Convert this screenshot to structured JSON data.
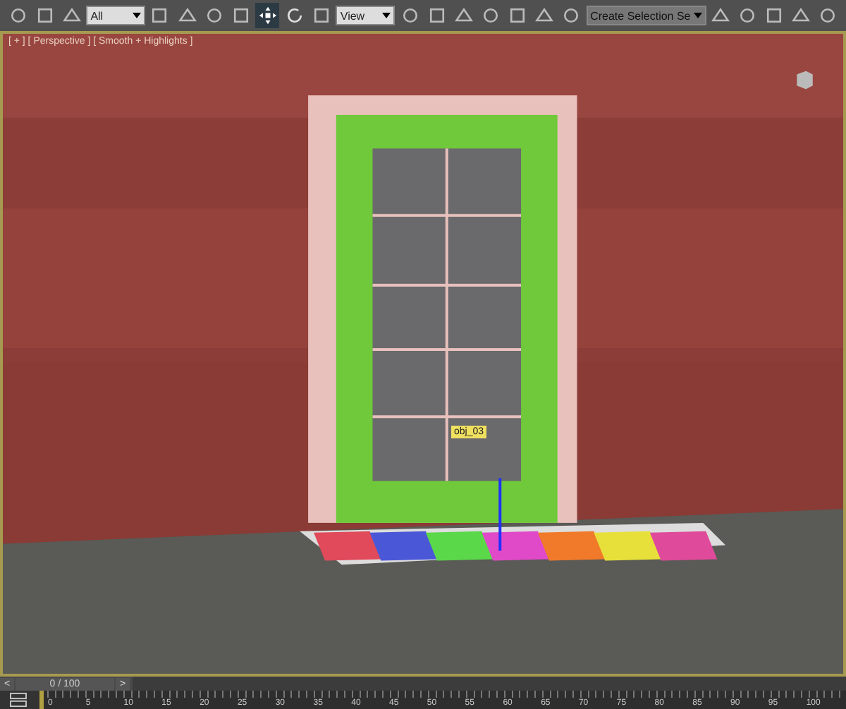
{
  "toolbar": {
    "items": [
      {
        "kind": "button",
        "selected": false
      },
      {
        "kind": "button",
        "selected": false
      },
      {
        "kind": "button",
        "selected": false
      },
      {
        "kind": "dropdown",
        "value": "All"
      },
      {
        "kind": "button",
        "selected": false
      },
      {
        "kind": "button",
        "selected": false
      },
      {
        "kind": "button",
        "selected": false
      },
      {
        "kind": "button",
        "selected": false
      },
      {
        "kind": "button",
        "selected": true
      },
      {
        "kind": "button",
        "selected": false
      },
      {
        "kind": "button",
        "selected": false
      },
      {
        "kind": "dropdown",
        "value": "View"
      },
      {
        "kind": "button",
        "selected": false
      },
      {
        "kind": "button",
        "selected": false
      },
      {
        "kind": "button",
        "selected": false
      },
      {
        "kind": "button",
        "selected": false
      },
      {
        "kind": "button",
        "selected": false
      },
      {
        "kind": "button",
        "selected": false
      },
      {
        "kind": "button",
        "selected": false
      },
      {
        "kind": "dropdown",
        "value": "Create Selection Se"
      },
      {
        "kind": "button",
        "selected": false
      },
      {
        "kind": "button",
        "selected": false
      },
      {
        "kind": "button",
        "selected": false
      },
      {
        "kind": "button",
        "selected": false
      },
      {
        "kind": "button",
        "selected": false
      }
    ]
  },
  "viewport": {
    "label": "[ + ] [ Perspective ] [ Smooth + Highlights ]",
    "object_label": "obj_03"
  },
  "time_slider": {
    "prev": "<",
    "position": "0 / 100",
    "next": ">",
    "level": 0
  },
  "track_bar": {
    "ticks": [
      "0",
      "5",
      "10",
      "15",
      "20",
      "25",
      "30",
      "35",
      "40",
      "45",
      "50",
      "55",
      "60",
      "65",
      "70",
      "75",
      "80",
      "85",
      "90",
      "95",
      "100"
    ]
  }
}
